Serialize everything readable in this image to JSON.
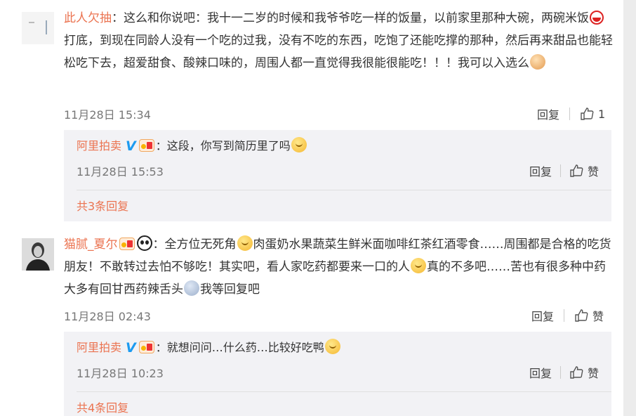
{
  "comments": [
    {
      "user": "此人欠抽",
      "text_1": "：这么和你说吧：我十一二岁的时候和我爷爷吃一样的饭量，以前家里那种大碗，两碗米饭",
      "text_2": "打底，到现在同龄人没有一个吃的过我，没有不吃的东西，吃饱了还能吃撑的那种，然后再来甜品也能轻松吃下去，超爱甜食、酸辣口味的，周围人都一直觉得我很能很能吃！！！我可以入选么",
      "time": "11月28日 15:34",
      "reply_label": "回复",
      "like_count": "1",
      "reply": {
        "user": "阿里拍卖",
        "text_1": "：这段，你写到简历里了吗",
        "time": "11月28日 15:53",
        "reply_label": "回复",
        "like_label": "赞"
      },
      "more_replies": "共3条回复"
    },
    {
      "user": "猫腻_夏尔",
      "text_1": "：全方位无死角",
      "text_2": "肉蛋奶水果蔬菜生鲜米面咖啡红茶红酒零食……周围都是合格的吃货朋友！不敢转过去怕不够吃！其实吧，看人家吃药都要来一口的人",
      "text_3": "真的不多吧……苦也有很多种中药大多有回甘西药辣舌头",
      "text_4": "我等回复吧",
      "time": "11月28日 02:43",
      "reply_label": "回复",
      "like_label": "赞",
      "reply": {
        "user": "阿里拍卖",
        "text_1": "：就想问问…什么药…比较好吃鸭",
        "time": "11月28日 10:23",
        "reply_label": "回复",
        "like_label": "赞"
      },
      "more_replies": "共4条回复"
    }
  ],
  "icons": {
    "verified": "verified-v-icon",
    "vip": "vip-badge-icon",
    "like": "thumb-up-icon"
  },
  "colors": {
    "username": "#eb7350",
    "verified": "#1d9bf0",
    "reply_bg": "#f2f2f5"
  }
}
